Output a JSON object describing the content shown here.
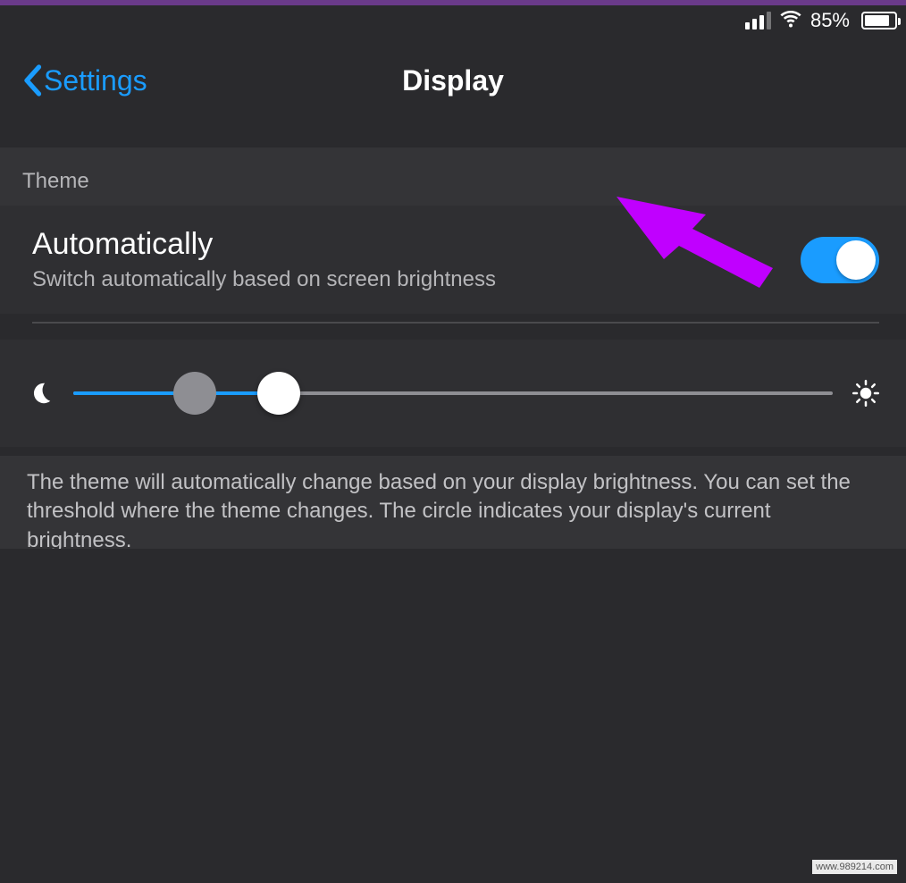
{
  "status": {
    "battery_percent": "85%"
  },
  "nav": {
    "back_label": "Settings",
    "title": "Display"
  },
  "section": {
    "theme_header": "Theme"
  },
  "auto": {
    "title": "Automatically",
    "subtitle": "Switch automatically based on screen brightness",
    "enabled": true
  },
  "slider": {
    "threshold_percent": 27,
    "current_brightness_percent": 16
  },
  "description": "The theme will automatically change based on your display brightness. You can set the threshold where the theme changes. The circle indicates your display's current brightness.",
  "watermark": "www.989214.com"
}
